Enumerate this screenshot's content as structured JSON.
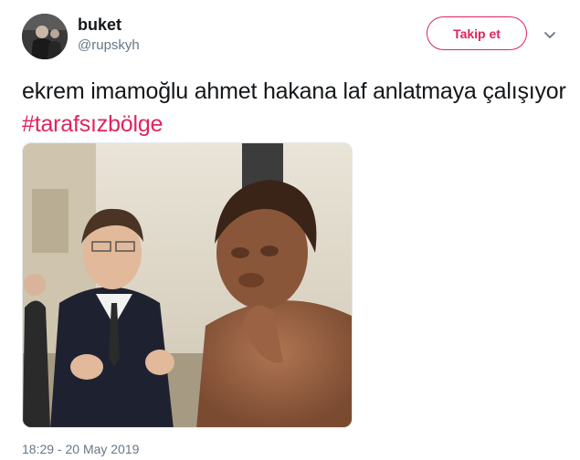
{
  "user": {
    "display_name": "buket",
    "handle": "@rupskyh"
  },
  "actions": {
    "follow_label": "Takip et"
  },
  "tweet": {
    "text_plain": "ekrem imamoğlu ahmet hakana laf anlatmaya çalışıyor ",
    "hashtag": "#tarafsızbölge",
    "timestamp": "18:29 - 20 May 2019"
  },
  "colors": {
    "accent": "#e0245e",
    "secondary_text": "#657786",
    "primary_text": "#14171a"
  },
  "icons": {
    "menu": "chevron-down-icon"
  }
}
